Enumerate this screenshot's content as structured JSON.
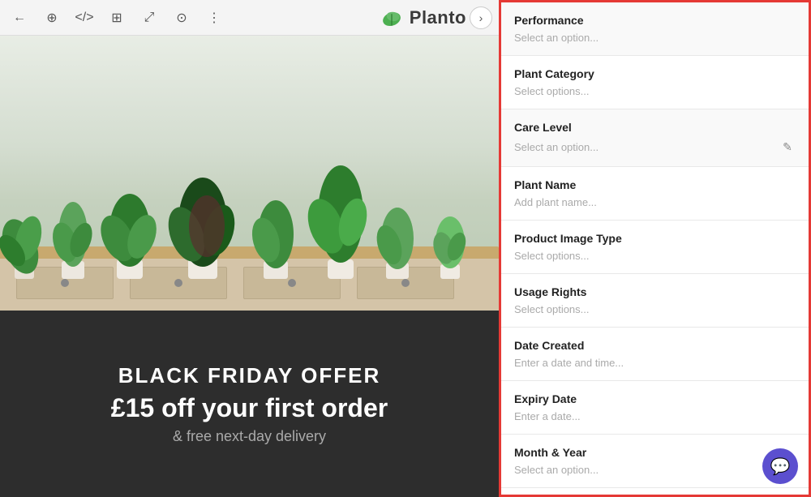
{
  "toolbar": {
    "back_label": "←",
    "zoom_icon": "⊕",
    "code_icon": "</>",
    "grid_icon": "⊞",
    "share_icon": "⤢",
    "user_icon": "⊙",
    "more_icon": "⋮",
    "nav_arrow": "›",
    "logo_text": "Planto"
  },
  "promo": {
    "offer_line": "BLACK FRIDAY OFFER",
    "discount_line": "£15 off your first order",
    "delivery_line": "& free next-day delivery"
  },
  "sidebar": {
    "fields": [
      {
        "label": "Performance",
        "placeholder": "Select an option...",
        "type": "select",
        "highlighted": true
      },
      {
        "label": "Plant Category",
        "placeholder": "Select options...",
        "type": "select",
        "highlighted": false
      },
      {
        "label": "Care Level",
        "placeholder": "Select an option...",
        "type": "select-edit",
        "highlighted": true
      },
      {
        "label": "Plant Name",
        "placeholder": "Add plant name...",
        "type": "text",
        "highlighted": false
      },
      {
        "label": "Product Image Type",
        "placeholder": "Select options...",
        "type": "select",
        "highlighted": false
      },
      {
        "label": "Usage Rights",
        "placeholder": "Select options...",
        "type": "select",
        "highlighted": false
      },
      {
        "label": "Date Created",
        "placeholder": "Enter a date and time...",
        "type": "datetime",
        "highlighted": false
      },
      {
        "label": "Expiry Date",
        "placeholder": "Enter a date...",
        "type": "date",
        "highlighted": false
      },
      {
        "label": "Month & Year",
        "placeholder": "Select an option...",
        "type": "select",
        "highlighted": false
      }
    ]
  },
  "chat": {
    "icon": "💬"
  }
}
